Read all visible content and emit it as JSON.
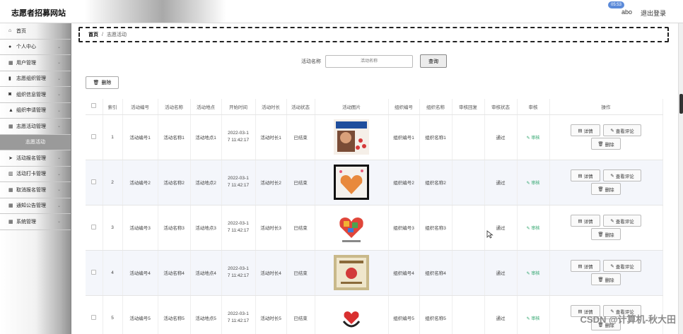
{
  "header": {
    "site_title": "志愿者招募网站",
    "clock": "05:53",
    "user": "abo",
    "logout": "退出登录"
  },
  "sidebar": {
    "items": [
      {
        "label": "首页",
        "icon": "home-icon",
        "glyph": "⌂",
        "has_chevron": false
      },
      {
        "label": "个人中心",
        "icon": "user-icon",
        "glyph": "●",
        "has_chevron": true
      },
      {
        "label": "用户管理",
        "icon": "grid-icon",
        "glyph": "▦",
        "has_chevron": true
      },
      {
        "label": "志愿组织管理",
        "icon": "building-icon",
        "glyph": "▮",
        "has_chevron": true
      },
      {
        "label": "组织信息管理",
        "icon": "info-icon",
        "glyph": "◙",
        "has_chevron": true
      },
      {
        "label": "组织申请管理",
        "icon": "person-icon",
        "glyph": "▲",
        "has_chevron": true
      },
      {
        "label": "志愿活动管理",
        "icon": "grid-icon",
        "glyph": "▦",
        "has_chevron": true
      },
      {
        "label": "志愿活动",
        "icon": "",
        "glyph": "",
        "has_chevron": false,
        "sub": true
      },
      {
        "label": "活动报名管理",
        "icon": "send-icon",
        "glyph": "➤",
        "has_chevron": true
      },
      {
        "label": "活动打卡管理",
        "icon": "chart-icon",
        "glyph": "▥",
        "has_chevron": true
      },
      {
        "label": "取消报名管理",
        "icon": "grid-icon",
        "glyph": "▦",
        "has_chevron": true
      },
      {
        "label": "通知公告管理",
        "icon": "grid-icon",
        "glyph": "▦",
        "has_chevron": true
      },
      {
        "label": "系统管理",
        "icon": "grid-icon",
        "glyph": "▦",
        "has_chevron": true
      }
    ]
  },
  "breadcrumb": {
    "home": "首页",
    "separator": "/",
    "current": "志愿活动"
  },
  "search": {
    "label": "活动名称",
    "placeholder": "活动名称",
    "button": "查询"
  },
  "toolbar": {
    "delete_label": "删除"
  },
  "table": {
    "headers": [
      "",
      "索引",
      "活动编号",
      "活动名称",
      "活动地点",
      "开始时间",
      "活动时长",
      "活动状态",
      "活动图片",
      "组织编号",
      "组织名称",
      "审核回复",
      "审核状态",
      "审核",
      "操作"
    ],
    "rows": [
      {
        "index": "1",
        "code": "活动编号1",
        "name": "活动名称1",
        "place": "活动地点1",
        "start_a": "2022-03-1",
        "start_b": "7 11:42:17",
        "duration": "活动时长1",
        "status": "已结束",
        "org_code": "组织编号1",
        "org_name": "组织名称1",
        "reply": "",
        "review_status": "通过",
        "review": "审核",
        "thumb": "volunteer-poster"
      },
      {
        "index": "2",
        "code": "活动编号2",
        "name": "活动名称2",
        "place": "活动地点2",
        "start_a": "2022-03-1",
        "start_b": "7 11:42:17",
        "duration": "活动时长2",
        "status": "已结束",
        "org_code": "组织编号2",
        "org_name": "组织名称2",
        "reply": "",
        "review_status": "通过",
        "review": "审核",
        "thumb": "heart-hands"
      },
      {
        "index": "3",
        "code": "活动编号3",
        "name": "活动名称3",
        "place": "活动地点3",
        "start_a": "2022-03-1",
        "start_b": "7 11:42:17",
        "duration": "活动时长3",
        "status": "已结束",
        "org_code": "组织编号3",
        "org_name": "组织名称3",
        "reply": "",
        "review_status": "通过",
        "review": "审核",
        "thumb": "heart-mosaic"
      },
      {
        "index": "4",
        "code": "活动编号4",
        "name": "活动名称4",
        "place": "活动地点4",
        "start_a": "2022-03-1",
        "start_b": "7 11:42:17",
        "duration": "活动时长4",
        "status": "已结束",
        "org_code": "组织编号4",
        "org_name": "组织名称4",
        "reply": "",
        "review_status": "通过",
        "review": "审核",
        "thumb": "certificate"
      },
      {
        "index": "5",
        "code": "活动编号5",
        "name": "活动名称5",
        "place": "活动地点5",
        "start_a": "2022-03-1",
        "start_b": "7 11:42:17",
        "duration": "活动时长5",
        "status": "已结束",
        "org_code": "组织编号5",
        "org_name": "组织名称5",
        "reply": "",
        "review_status": "通过",
        "review": "审核",
        "thumb": "heart-logo"
      }
    ],
    "actions": {
      "detail": "详情",
      "comment": "查看评论",
      "delete": "删除"
    }
  },
  "watermark": "CSDN @计算机-秋大田",
  "colors": {
    "review_green": "#2aa36a",
    "alt_row": "#f4f6fb",
    "clock_blue": "#5b8ad9"
  }
}
